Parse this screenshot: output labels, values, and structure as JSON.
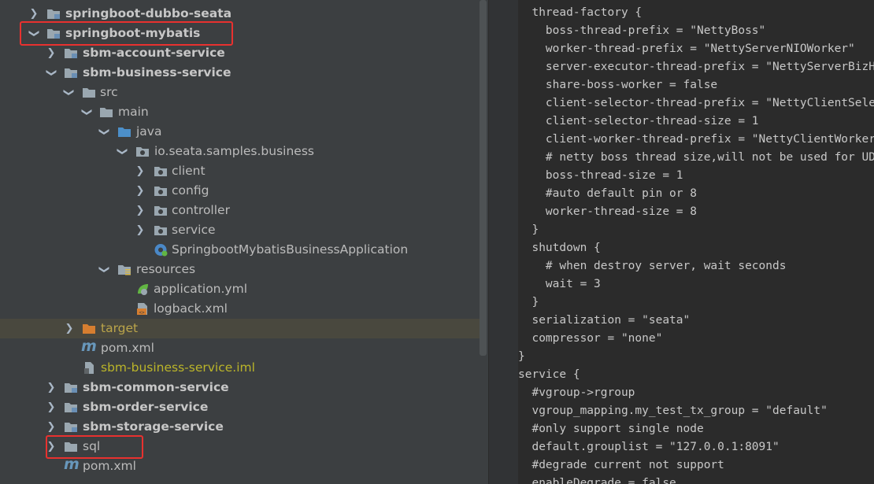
{
  "project_tree": {
    "items": [
      {
        "label": "springboot-dubbo-seata",
        "style": "bold",
        "icon": "module-folder-icon",
        "arrow": "collapsed"
      },
      {
        "label": "springboot-mybatis",
        "style": "bold",
        "icon": "module-folder-icon",
        "arrow": "expanded"
      },
      {
        "label": "sbm-account-service",
        "style": "bold",
        "icon": "module-folder-icon",
        "arrow": "collapsed"
      },
      {
        "label": "sbm-business-service",
        "style": "bold",
        "icon": "module-folder-icon",
        "arrow": "expanded"
      },
      {
        "label": "src",
        "style": "normal",
        "icon": "folder-icon",
        "arrow": "expanded"
      },
      {
        "label": "main",
        "style": "normal",
        "icon": "folder-icon",
        "arrow": "expanded"
      },
      {
        "label": "java",
        "style": "normal",
        "icon": "source-folder-icon",
        "arrow": "expanded"
      },
      {
        "label": "io.seata.samples.business",
        "style": "normal",
        "icon": "package-icon",
        "arrow": "expanded"
      },
      {
        "label": "client",
        "style": "normal",
        "icon": "package-icon",
        "arrow": "collapsed"
      },
      {
        "label": "config",
        "style": "normal",
        "icon": "package-icon",
        "arrow": "collapsed"
      },
      {
        "label": "controller",
        "style": "normal",
        "icon": "package-icon",
        "arrow": "collapsed"
      },
      {
        "label": "service",
        "style": "normal",
        "icon": "package-icon",
        "arrow": "collapsed"
      },
      {
        "label": "SpringbootMybatisBusinessApplication",
        "style": "normal",
        "icon": "spring-boot-class-icon",
        "arrow": "none"
      },
      {
        "label": "resources",
        "style": "normal",
        "icon": "resources-folder-icon",
        "arrow": "expanded"
      },
      {
        "label": "application.yml",
        "style": "normal",
        "icon": "spring-yml-icon",
        "arrow": "none"
      },
      {
        "label": "logback.xml",
        "style": "normal",
        "icon": "xml-file-icon",
        "arrow": "none"
      },
      {
        "label": "target",
        "style": "excluded",
        "icon": "excluded-folder-icon",
        "arrow": "collapsed"
      },
      {
        "label": "pom.xml",
        "style": "normal",
        "icon": "maven-icon",
        "arrow": "none"
      },
      {
        "label": "sbm-business-service.iml",
        "style": "iml",
        "icon": "iml-file-icon",
        "arrow": "none"
      },
      {
        "label": "sbm-common-service",
        "style": "bold",
        "icon": "module-folder-icon",
        "arrow": "collapsed"
      },
      {
        "label": "sbm-order-service",
        "style": "bold",
        "icon": "module-folder-icon",
        "arrow": "collapsed"
      },
      {
        "label": "sbm-storage-service",
        "style": "bold",
        "icon": "module-folder-icon",
        "arrow": "collapsed"
      },
      {
        "label": "sql",
        "style": "normal",
        "icon": "folder-icon",
        "arrow": "collapsed"
      },
      {
        "label": "pom.xml",
        "style": "normal",
        "icon": "maven-icon",
        "arrow": "none"
      }
    ]
  },
  "editor": {
    "lines": [
      "  thread-factory {",
      "    boss-thread-prefix = \"NettyBoss\"",
      "    worker-thread-prefix = \"NettyServerNIOWorker\"",
      "    server-executor-thread-prefix = \"NettyServerBizHandler\"",
      "    share-boss-worker = false",
      "    client-selector-thread-prefix = \"NettyClientSelector\"",
      "    client-selector-thread-size = 1",
      "    client-worker-thread-prefix = \"NettyClientWorkerThread\"",
      "    # netty boss thread size,will not be used for UDT",
      "    boss-thread-size = 1",
      "    #auto default pin or 8",
      "    worker-thread-size = 8",
      "  }",
      "  shutdown {",
      "    # when destroy server, wait seconds",
      "    wait = 3",
      "  }",
      "  serialization = \"seata\"",
      "  compressor = \"none\"",
      "}",
      "service {",
      "  #vgroup->rgroup",
      "  vgroup_mapping.my_test_tx_group = \"default\"",
      "  #only support single node",
      "  default.grouplist = \"127.0.0.1:8091\"",
      "  #degrade current not support",
      "  enableDegrade = false"
    ]
  },
  "colors": {
    "annotation": "#e8312f",
    "tree_background": "#3c3f41",
    "editor_background": "#2b2b2b"
  }
}
